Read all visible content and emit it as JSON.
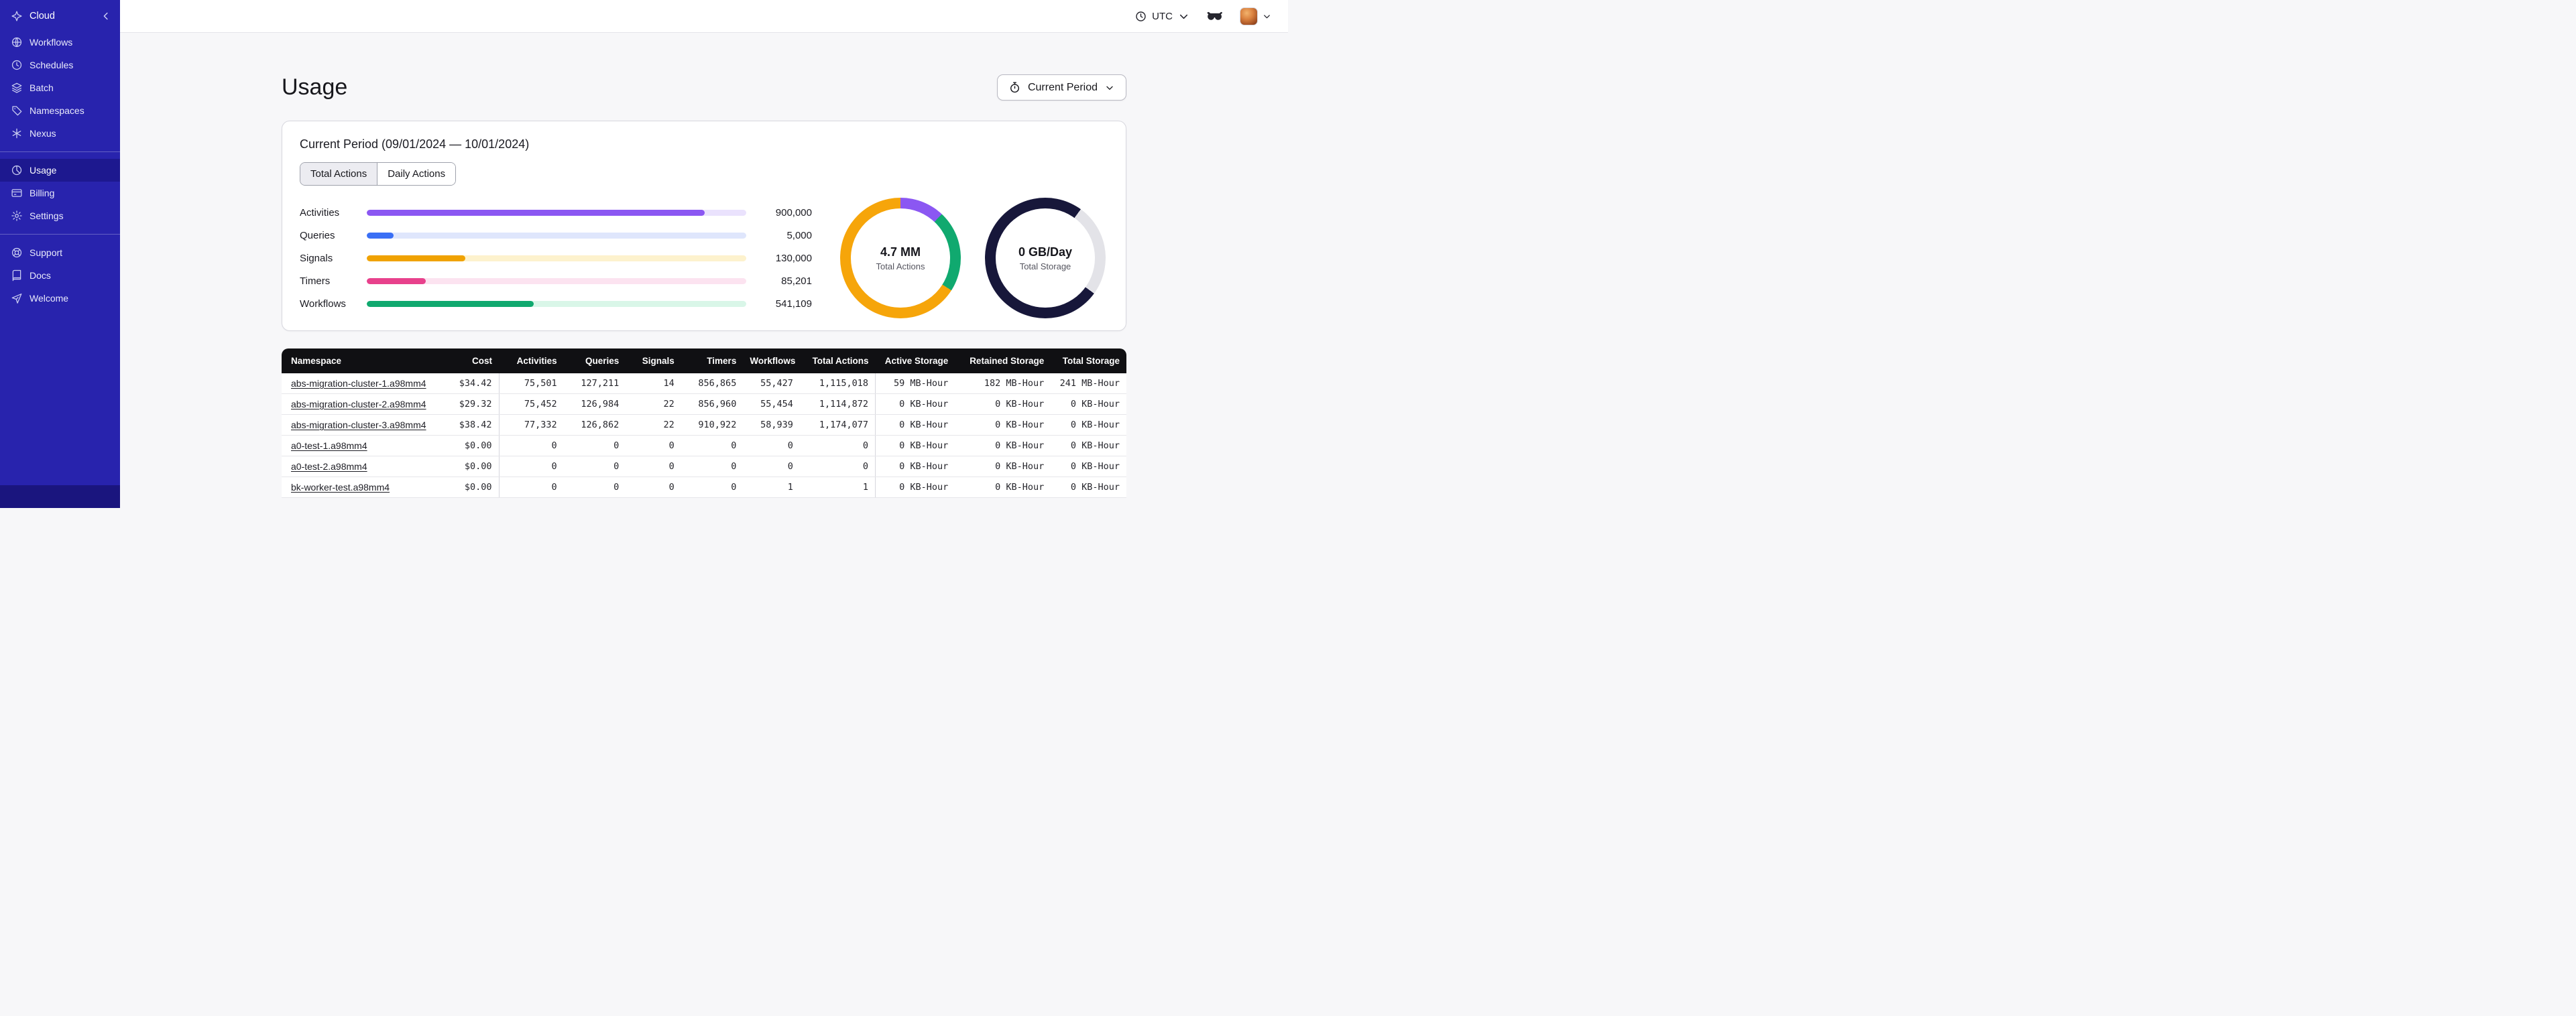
{
  "sidebar": {
    "brand_label": "Cloud",
    "nav_main": [
      {
        "label": "Workflows",
        "icon": "workflows-icon",
        "active": false
      },
      {
        "label": "Schedules",
        "icon": "schedules-icon",
        "active": false
      },
      {
        "label": "Batch",
        "icon": "batch-icon",
        "active": false
      },
      {
        "label": "Namespaces",
        "icon": "namespaces-icon",
        "active": false
      },
      {
        "label": "Nexus",
        "icon": "nexus-icon",
        "active": false
      }
    ],
    "nav_account": [
      {
        "label": "Usage",
        "icon": "usage-icon",
        "active": true
      },
      {
        "label": "Billing",
        "icon": "billing-icon",
        "active": false
      },
      {
        "label": "Settings",
        "icon": "settings-icon",
        "active": false
      }
    ],
    "nav_help": [
      {
        "label": "Support",
        "icon": "support-icon",
        "active": false
      },
      {
        "label": "Docs",
        "icon": "docs-icon",
        "active": false
      },
      {
        "label": "Welcome",
        "icon": "welcome-icon",
        "active": false
      }
    ]
  },
  "topbar": {
    "timezone": "UTC"
  },
  "page": {
    "title": "Usage",
    "period_button_label": "Current Period"
  },
  "usage_card": {
    "title": "Current Period (09/01/2024 — 10/01/2024)",
    "tabs": [
      {
        "label": "Total Actions",
        "active": true
      },
      {
        "label": "Daily Actions",
        "active": false
      }
    ],
    "bars": [
      {
        "label": "Activities",
        "value": "900,000",
        "percent": 89,
        "color": "#8b57f2",
        "track_color": "#eae2fd"
      },
      {
        "label": "Queries",
        "value": "5,000",
        "percent": 7,
        "color": "#3a6ff5",
        "track_color": "#dfe6fc"
      },
      {
        "label": "Signals",
        "value": "130,000",
        "percent": 26,
        "color": "#f0a202",
        "track_color": "#fdf2cd"
      },
      {
        "label": "Timers",
        "value": "85,201",
        "percent": 15.5,
        "color": "#e8418c",
        "track_color": "#fce3f0"
      },
      {
        "label": "Workflows",
        "value": "541,109",
        "percent": 44,
        "color": "#10a96f",
        "track_color": "#d9f6e8"
      }
    ],
    "donuts": [
      {
        "value": "4.7 MM",
        "label": "Total Actions",
        "segments": [
          {
            "color": "#8b57f2",
            "percent": 12
          },
          {
            "color": "#10a96f",
            "percent": 22
          },
          {
            "color": "#f6a50a",
            "percent": 66
          }
        ]
      },
      {
        "value": "0 GB/Day",
        "label": "Total Storage",
        "segments": [
          {
            "color": "#17173a",
            "percent": 10
          },
          {
            "color": "#e3e3e8",
            "percent": 25
          },
          {
            "color": "#17173a",
            "percent": 65
          }
        ]
      }
    ]
  },
  "table": {
    "headers": [
      "Namespace",
      "Cost",
      "Activities",
      "Queries",
      "Signals",
      "Timers",
      "Workflows",
      "Total Actions",
      "Active Storage",
      "Retained Storage",
      "Total Storage"
    ],
    "rows": [
      [
        "abs-migration-cluster-1.a98mm4",
        "$34.42",
        "75,501",
        "127,211",
        "14",
        "856,865",
        "55,427",
        "1,115,018",
        "59 MB-Hour",
        "182 MB-Hour",
        "241 MB-Hour"
      ],
      [
        "abs-migration-cluster-2.a98mm4",
        "$29.32",
        "75,452",
        "126,984",
        "22",
        "856,960",
        "55,454",
        "1,114,872",
        "0 KB-Hour",
        "0 KB-Hour",
        "0 KB-Hour"
      ],
      [
        "abs-migration-cluster-3.a98mm4",
        "$38.42",
        "77,332",
        "126,862",
        "22",
        "910,922",
        "58,939",
        "1,174,077",
        "0 KB-Hour",
        "0 KB-Hour",
        "0 KB-Hour"
      ],
      [
        "a0-test-1.a98mm4",
        "$0.00",
        "0",
        "0",
        "0",
        "0",
        "0",
        "0",
        "0 KB-Hour",
        "0 KB-Hour",
        "0 KB-Hour"
      ],
      [
        "a0-test-2.a98mm4",
        "$0.00",
        "0",
        "0",
        "0",
        "0",
        "0",
        "0",
        "0 KB-Hour",
        "0 KB-Hour",
        "0 KB-Hour"
      ],
      [
        "bk-worker-test.a98mm4",
        "$0.00",
        "0",
        "0",
        "0",
        "0",
        "1",
        "1",
        "0 KB-Hour",
        "0 KB-Hour",
        "0 KB-Hour"
      ]
    ]
  }
}
